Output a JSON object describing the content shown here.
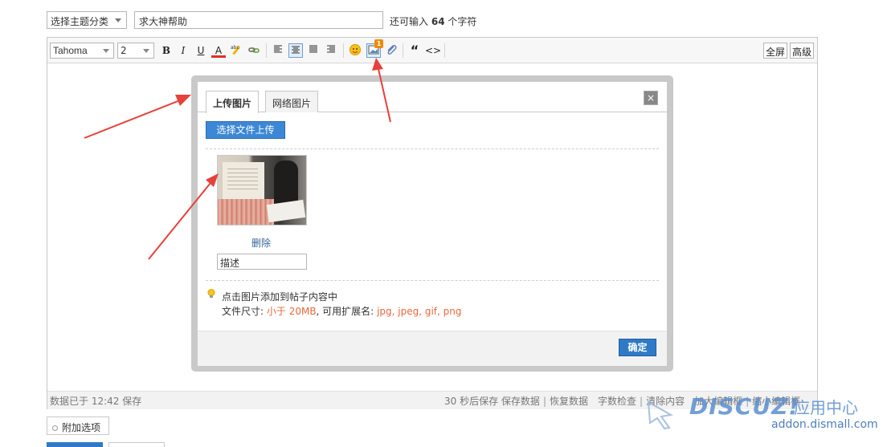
{
  "top": {
    "topic_select": "选择主题分类",
    "title_value": "求大神帮助",
    "count_prefix": "还可输入",
    "count_value": "64",
    "count_suffix": "个字符"
  },
  "toolbar": {
    "font": "Tahoma",
    "size": "2",
    "bold": "B",
    "italic": "I",
    "underline": "U",
    "font_color": "A",
    "quote": "“",
    "code": "<>",
    "fullscreen": "全屏",
    "advanced": "高级",
    "badge": "1"
  },
  "dialog": {
    "tab_upload": "上传图片",
    "tab_web": "网络图片",
    "close": "×",
    "upload_button": "选择文件上传",
    "delete": "删除",
    "desc_value": "描述",
    "tip1": "点击图片添加到帖子内容中",
    "tip2_prefix": "文件尺寸:",
    "tip2_size": "小于 20MB",
    "tip2_mid": ", 可用扩展名:",
    "tip2_ext": "jpg, jpeg, gif, png",
    "ok": "确定"
  },
  "status": {
    "saved": "数据已于 12:42 保存",
    "autosave": "30 秒后保存",
    "save_data": "保存数据",
    "restore_data": "恢复数据",
    "word_check": "字数检查",
    "clear_content": "清除内容",
    "enlarge": "加大编辑框",
    "shrink": "缩小编辑框"
  },
  "attach_options": "附加选项",
  "watermark": {
    "brand": "DISCUZ!",
    "sub": "应用中心",
    "url": "addon.dismall.com"
  },
  "colors": {
    "primary_blue": "#2f7ac6",
    "arrow_red": "#e8403a",
    "highlight_orange": "#e8683c"
  }
}
